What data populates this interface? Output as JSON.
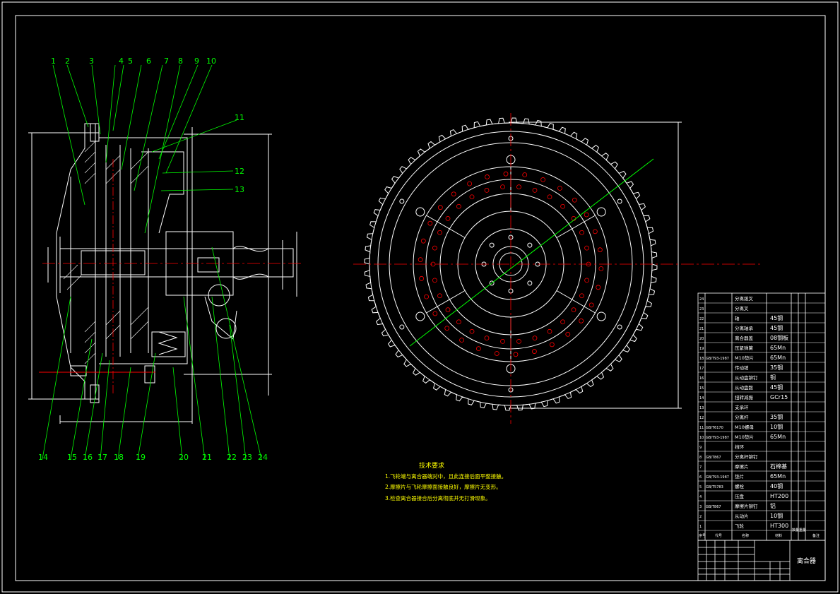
{
  "drawing": {
    "title": "离合器",
    "tech_requirements": {
      "heading": "技术要求",
      "items": [
        "1.飞轮端与离合器端对中，且此连接后面平整接触。",
        "2.摩擦片与飞轮摩擦面接触良好，摩擦片无变形。",
        "3.检查离合器接合后分离彻底并无打滑现象。"
      ]
    },
    "part_labels_top": [
      "1",
      "2",
      "3",
      "4",
      "5",
      "6",
      "7",
      "8",
      "9",
      "10"
    ],
    "part_labels_right": [
      "11",
      "12",
      "13"
    ],
    "part_labels_bottom": [
      "14",
      "15",
      "16",
      "17",
      "18",
      "19",
      "20",
      "21",
      "22",
      "23",
      "24"
    ],
    "colors": {
      "background": "#000000",
      "outline": "#ffffff",
      "leader": "#00ff00",
      "centerline": "#ff0000",
      "text_yellow": "#ffff00"
    },
    "bom": [
      {
        "no": "24",
        "code": "",
        "name": "分离拨叉",
        "qty": "",
        "material": ""
      },
      {
        "no": "23",
        "code": "",
        "name": "分离叉",
        "qty": "",
        "material": ""
      },
      {
        "no": "22",
        "code": "",
        "name": "轴",
        "qty": "",
        "material": "45钢"
      },
      {
        "no": "21",
        "code": "",
        "name": "分离轴承",
        "qty": "",
        "material": "45钢"
      },
      {
        "no": "20",
        "code": "",
        "name": "离合器盖",
        "qty": "",
        "material": "08钢板"
      },
      {
        "no": "19",
        "code": "",
        "name": "压紧弹簧",
        "qty": "",
        "material": "65Mn"
      },
      {
        "no": "18",
        "code": "GB/T93-1987",
        "name": "M10垫片",
        "qty": "",
        "material": "65Mn"
      },
      {
        "no": "17",
        "code": "",
        "name": "传动销",
        "qty": "",
        "material": "35钢"
      },
      {
        "no": "16",
        "code": "",
        "name": "从动盘铆钉",
        "qty": "",
        "material": "铜"
      },
      {
        "no": "15",
        "code": "",
        "name": "从动盘毂",
        "qty": "",
        "material": "45钢"
      },
      {
        "no": "14",
        "code": "",
        "name": "扭转减振",
        "qty": "",
        "material": "GCr15"
      },
      {
        "no": "13",
        "code": "",
        "name": "支承环",
        "qty": "",
        "material": ""
      },
      {
        "no": "12",
        "code": "",
        "name": "分离杆",
        "qty": "",
        "material": "35钢"
      },
      {
        "no": "11",
        "code": "GB/T6170",
        "name": "M10螺母",
        "qty": "",
        "material": "10钢"
      },
      {
        "no": "10",
        "code": "GB/T93-1987",
        "name": "M10垫片",
        "qty": "",
        "material": "65Mn"
      },
      {
        "no": "9",
        "code": "",
        "name": "挡环",
        "qty": "",
        "material": ""
      },
      {
        "no": "8",
        "code": "GB/T867",
        "name": "分离杆铆钉",
        "qty": "",
        "material": ""
      },
      {
        "no": "7",
        "code": "",
        "name": "摩擦片",
        "qty": "",
        "material": "石棉基"
      },
      {
        "no": "6",
        "code": "GB/T93-1987",
        "name": "垫片",
        "qty": "",
        "material": "65Mn"
      },
      {
        "no": "5",
        "code": "GB/T5783",
        "name": "螺栓",
        "qty": "",
        "material": "40钢"
      },
      {
        "no": "4",
        "code": "",
        "name": "压盘",
        "qty": "",
        "material": "HT200"
      },
      {
        "no": "3",
        "code": "GB/T867",
        "name": "摩擦片铆钉",
        "qty": "",
        "material": "铝"
      },
      {
        "no": "2",
        "code": "",
        "name": "从动片",
        "qty": "",
        "material": "10钢"
      },
      {
        "no": "1",
        "code": "",
        "name": "飞轮",
        "qty": "",
        "material": "HT300"
      }
    ],
    "bom_header": {
      "no": "序号",
      "code": "代号",
      "name": "名称",
      "qty": "数量",
      "material": "材料",
      "weight": "重量",
      "remark": "备注"
    }
  }
}
